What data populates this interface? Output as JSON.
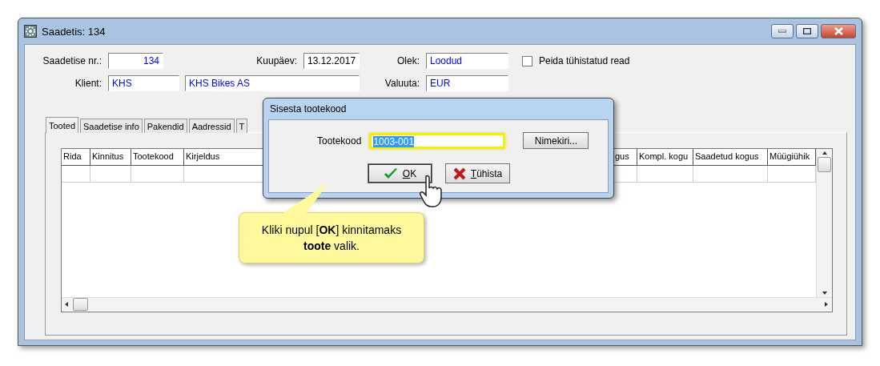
{
  "window": {
    "title": "Saadetis: 134"
  },
  "form": {
    "number_label": "Saadetise nr.:",
    "number": "134",
    "date_label": "Kuupäev:",
    "date": "13.12.2017",
    "status_label": "Olek:",
    "status": "Loodud",
    "hide_cancelled": {
      "label": "Peida tühistatud read",
      "checked": false
    },
    "client_label": "Klient:",
    "client_code": "KHS",
    "client_name": "KHS Bikes AS",
    "currency_label": "Valuuta:",
    "currency": "EUR"
  },
  "tabs": [
    {
      "label": "Tooted",
      "selected": true
    },
    {
      "label": "Saadetise info",
      "selected": false
    },
    {
      "label": "Pakendid",
      "selected": false
    },
    {
      "label": "Aadressid",
      "selected": false
    },
    {
      "label": "T",
      "selected": false
    }
  ],
  "table": {
    "columns": [
      "Rida",
      "Kinnitus",
      "Tootekood",
      "Kirjeldus",
      "gus",
      "Kompl. kogu",
      "Saadetud kogus",
      "Müügiühik"
    ]
  },
  "dialog": {
    "title": "Sisesta tootekood",
    "field_label": "Tootekood",
    "value": "1003-001",
    "list_button": "Nimekiri...",
    "ok_button": "OK",
    "cancel_button": "Tühista"
  },
  "callout": {
    "text": "Kliki nupul [**OK**] kinnitamaks **toote** valik."
  }
}
